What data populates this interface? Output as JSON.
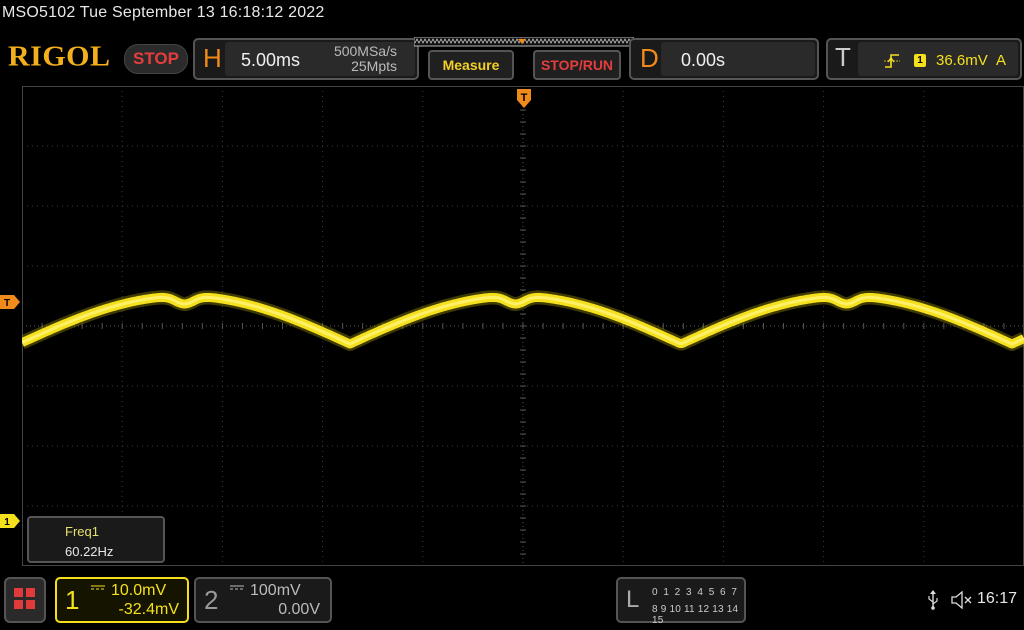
{
  "header": {
    "title_line": "MSO5102  Tue September 13 16:18:12 2022",
    "logo": "RIGOL",
    "run_state": "STOP"
  },
  "horizontal": {
    "letter": "H",
    "timebase": "5.00ms",
    "sample_rate": "500MSa/s",
    "memory_depth": "25Mpts"
  },
  "buttons": {
    "measure": "Measure",
    "stop_run": "STOP/RUN"
  },
  "delay": {
    "letter": "D",
    "value": "0.00s"
  },
  "trigger": {
    "letter": "T",
    "source": "1",
    "level": "36.6mV",
    "mode": "A",
    "marker": "T"
  },
  "measurement": {
    "name": "Freq1",
    "value": "60.22Hz"
  },
  "channel1": {
    "number": "1",
    "scale": "10.0mV",
    "offset": "-32.4mV",
    "color": "#f4e01c"
  },
  "channel2": {
    "number": "2",
    "scale": "100mV",
    "offset": "0.00V"
  },
  "logic": {
    "letter": "L",
    "row1": "0 1 2 3   4 5 6 7",
    "row2": "8 9 10 11 12 13 14 15"
  },
  "status": {
    "time": "16:17"
  },
  "colors": {
    "accent_orange": "#f08a1a",
    "channel1_yellow": "#f4e01c",
    "stop_red": "#e53d3d"
  }
}
